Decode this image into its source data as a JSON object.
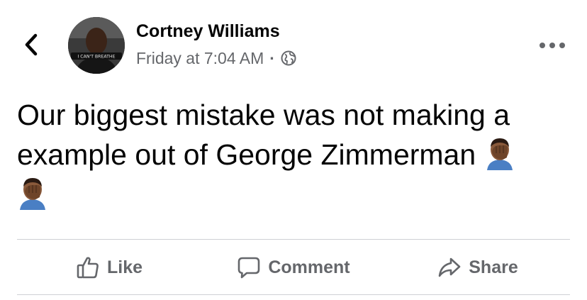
{
  "post": {
    "author_name": "Cortney Williams",
    "avatar_caption": "I CAN'T BREATHE",
    "timestamp": "Friday at 7:04 AM",
    "separator": "·",
    "privacy_icon": "globe-icon",
    "text_line1": "Our biggest mistake was not making a",
    "text_line2": "example out of George Zimmerman",
    "emoji": "face-palm-emoji"
  },
  "header": {
    "back_icon": "chevron-left-icon",
    "more_icon": "ellipsis-icon"
  },
  "actions": {
    "like_label": "Like",
    "comment_label": "Comment",
    "share_label": "Share"
  },
  "colors": {
    "text_primary": "#050505",
    "text_secondary": "#65676b",
    "divider": "#ced0d4"
  }
}
